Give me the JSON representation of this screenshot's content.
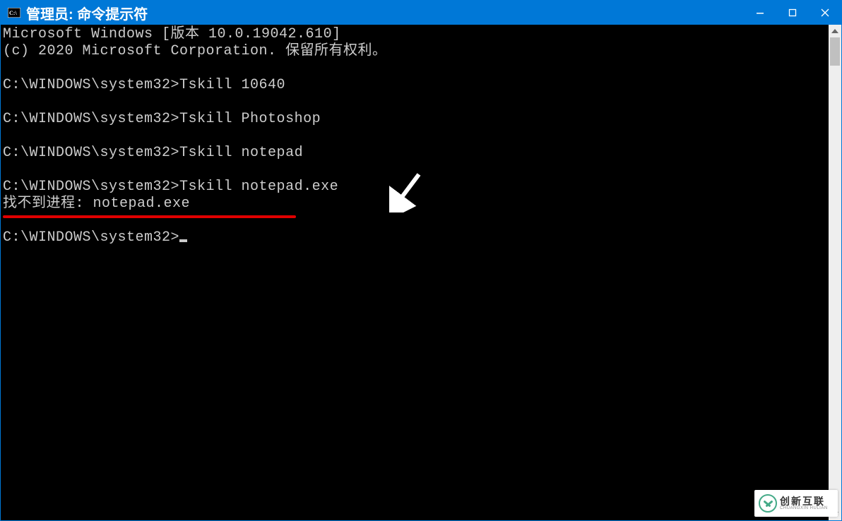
{
  "window": {
    "title": "管理员: 命令提示符"
  },
  "terminal": {
    "lines": [
      "Microsoft Windows [版本 10.0.19042.610]",
      "(c) 2020 Microsoft Corporation. 保留所有权利。",
      "",
      "C:\\WINDOWS\\system32>Tskill 10640",
      "",
      "C:\\WINDOWS\\system32>Tskill Photoshop",
      "",
      "C:\\WINDOWS\\system32>Tskill notepad",
      "",
      "C:\\WINDOWS\\system32>Tskill notepad.exe",
      "找不到进程: notepad.exe",
      "",
      "C:\\WINDOWS\\system32>"
    ],
    "current_prompt_has_cursor": true
  },
  "annotations": {
    "underline": {
      "target_line_index": 10,
      "color": "#e00000"
    },
    "arrow": {
      "points_to_line_index": 9
    }
  },
  "watermark": {
    "cn": "创新互联",
    "en": "CHUANGXIN HULIAN"
  }
}
